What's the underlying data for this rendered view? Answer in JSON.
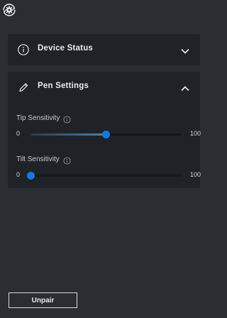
{
  "app": {
    "top_icon": "gear-sync-icon"
  },
  "device_status": {
    "title": "Device Status",
    "icon": "info-circle-icon",
    "expanded": false
  },
  "pen_settings": {
    "title": "Pen Settings",
    "icon": "pencil-icon",
    "expanded": true,
    "sliders": [
      {
        "label": "Tip Sensitivity",
        "min": "0",
        "max": "100",
        "value": 50
      },
      {
        "label": "Tilt Sensitivity",
        "min": "0",
        "max": "100",
        "value": 0
      }
    ]
  },
  "footer": {
    "unpair_label": "Unpair"
  },
  "colors": {
    "accent": "#1677e0",
    "background": "#2a2d32",
    "panel": "#1f2226"
  }
}
